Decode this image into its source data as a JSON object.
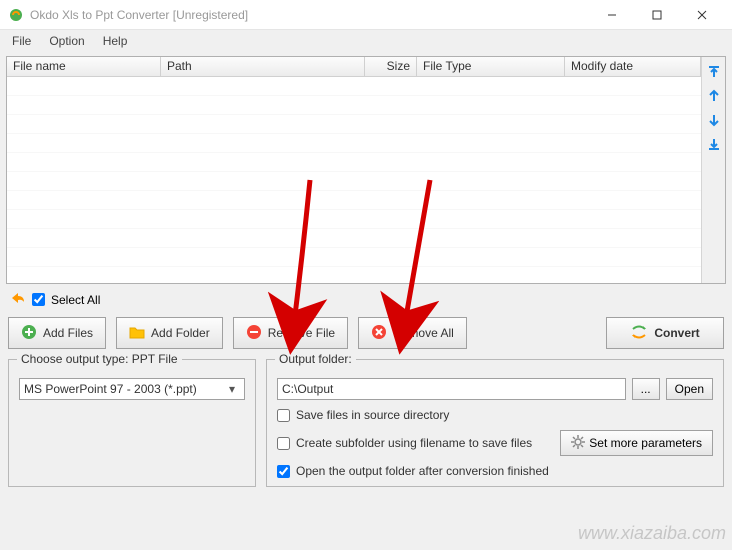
{
  "window": {
    "title": "Okdo Xls to Ppt Converter [Unregistered]"
  },
  "menu": {
    "file": "File",
    "option": "Option",
    "help": "Help"
  },
  "columns": {
    "filename": "File name",
    "path": "Path",
    "size": "Size",
    "filetype": "File Type",
    "modify": "Modify date"
  },
  "selectall": "Select All",
  "buttons": {
    "addfiles": "Add Files",
    "addfolder": "Add Folder",
    "removefile": "Remove File",
    "removeall": "Remove All",
    "convert": "Convert",
    "browse": "...",
    "open": "Open",
    "setmore": "Set more parameters"
  },
  "outputtype": {
    "legend": "Choose output type:  PPT File",
    "value": "MS PowerPoint 97 - 2003 (*.ppt)"
  },
  "outputfolder": {
    "legend": "Output folder:",
    "path": "C:\\Output"
  },
  "checks": {
    "savesrc": "Save files in source directory",
    "subfolder": "Create subfolder using filename to save files",
    "openafter": "Open the output folder after conversion finished"
  },
  "watermark": "www.xiazaiba.com"
}
